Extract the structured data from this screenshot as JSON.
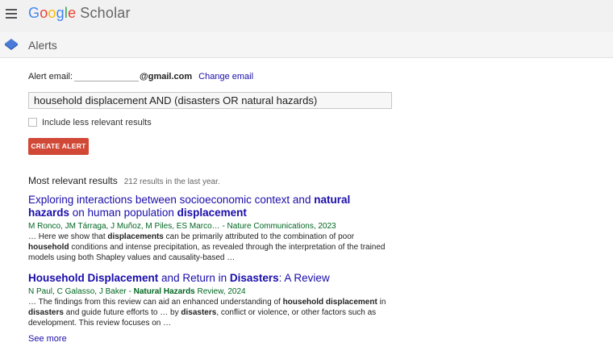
{
  "app": {
    "logo_letters": [
      "G",
      "o",
      "o",
      "g",
      "l",
      "e"
    ],
    "logo_suffix": "Scholar",
    "section_title": "Alerts"
  },
  "alert_form": {
    "email_label": "Alert email:",
    "email_domain": "@gmail.com",
    "change_email": "Change email",
    "query_value": "household displacement AND (disasters OR natural hazards)",
    "include_less_relevant": "Include less relevant results",
    "include_less_relevant_checked": false,
    "create_button": "CREATE ALERT",
    "button_color": "#d14836"
  },
  "results": {
    "heading": "Most relevant results",
    "count_text": "212 results in the last year.",
    "items": [
      {
        "title_parts": [
          {
            "t": "Exploring interactions between socioeconomic context and ",
            "b": false
          },
          {
            "t": "natural hazards",
            "b": true
          },
          {
            "t": " on human population ",
            "b": false
          },
          {
            "t": "displacement",
            "b": true
          }
        ],
        "meta_parts": [
          {
            "t": "M Ronco, JM Tárraga, J Muñoz, M Piles, ES Marco… - Nature Communications, 2023",
            "b": false
          }
        ],
        "snippet_parts": [
          {
            "t": "… Here we show that ",
            "b": false
          },
          {
            "t": "displacements",
            "b": true
          },
          {
            "t": " can be primarily attributed to the combination of poor ",
            "b": false
          },
          {
            "t": "household",
            "b": true
          },
          {
            "t": " conditions and intense precipitation, as revealed through the interpretation of the trained models using both Shapley values and causality-based …",
            "b": false
          }
        ]
      },
      {
        "title_parts": [
          {
            "t": "Household Displacement",
            "b": true
          },
          {
            "t": " and Return in ",
            "b": false
          },
          {
            "t": "Disasters",
            "b": true
          },
          {
            "t": ": A Review",
            "b": false
          }
        ],
        "meta_parts": [
          {
            "t": "N Paul, C Galasso, J Baker - ",
            "b": false
          },
          {
            "t": "Natural Hazards",
            "b": true
          },
          {
            "t": " Review, 2024",
            "b": false
          }
        ],
        "snippet_parts": [
          {
            "t": "… The findings from this review can aid an enhanced understanding of ",
            "b": false
          },
          {
            "t": "household displacement",
            "b": true
          },
          {
            "t": " in ",
            "b": false
          },
          {
            "t": "disasters",
            "b": true
          },
          {
            "t": " and guide future efforts to … by ",
            "b": false
          },
          {
            "t": "disasters",
            "b": true
          },
          {
            "t": ", conflict or violence, or other factors such as development. This review focuses on …",
            "b": false
          }
        ]
      }
    ],
    "see_more": "See more"
  },
  "colors": {
    "link": "#1a0dab",
    "meta": "#006621",
    "topbar": "#f1f1f1"
  }
}
